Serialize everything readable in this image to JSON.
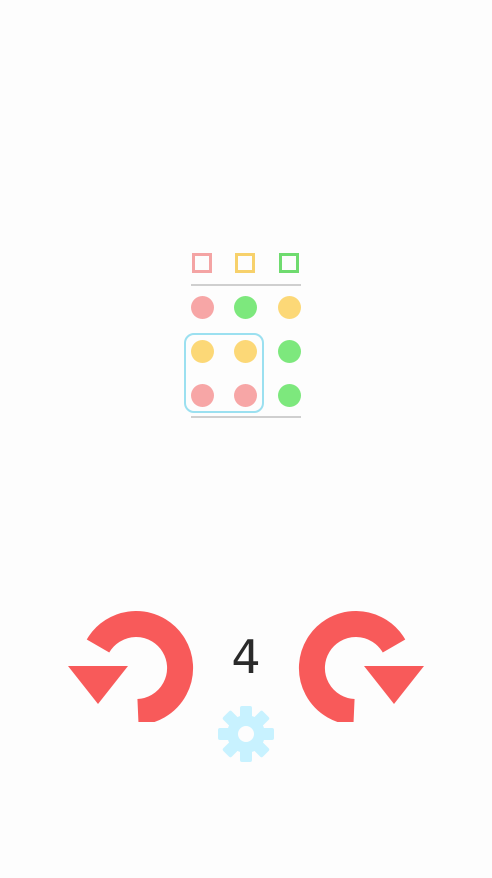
{
  "puzzle": {
    "targets": [
      {
        "color": "#f4a4a4",
        "name": "red"
      },
      {
        "color": "#f7d16b",
        "name": "yellow"
      },
      {
        "color": "#6fdb6f",
        "name": "green"
      }
    ],
    "grid": [
      [
        "#f7a6a6",
        "#7de87d",
        "#fcd877"
      ],
      [
        "#fcd877",
        "#fcd877",
        "#7de87d"
      ],
      [
        "#f7a6a6",
        "#f7a6a6",
        "#7de87d"
      ]
    ],
    "selection": {
      "rows": [
        1,
        2
      ],
      "cols": [
        0,
        1
      ]
    }
  },
  "controls": {
    "moves_left": "4",
    "rotate_left_icon": "rotate-counterclockwise-icon",
    "rotate_right_icon": "rotate-clockwise-icon",
    "settings_icon": "gear-icon",
    "arrow_color": "#f85a5a",
    "gear_color": "#c8f2ff"
  }
}
